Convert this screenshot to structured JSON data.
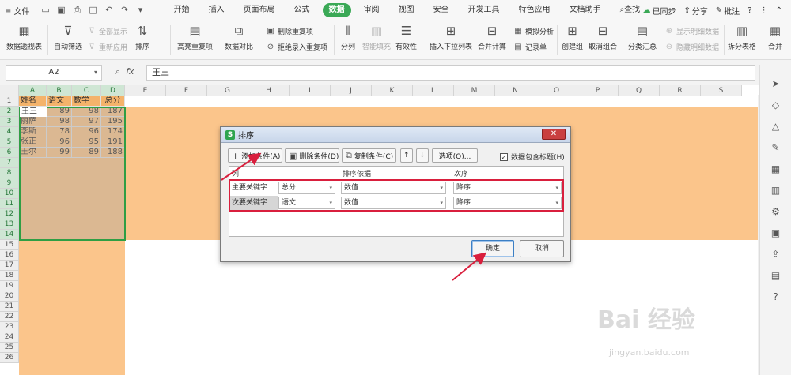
{
  "menubar": {
    "file_label": "≡ 文件",
    "tabs": [
      {
        "label": "开始",
        "active": false
      },
      {
        "label": "插入",
        "active": false
      },
      {
        "label": "页面布局",
        "active": false
      },
      {
        "label": "公式",
        "active": false
      },
      {
        "label": "数据",
        "active": true
      },
      {
        "label": "审阅",
        "active": false
      },
      {
        "label": "视图",
        "active": false
      },
      {
        "label": "安全",
        "active": false
      },
      {
        "label": "开发工具",
        "active": false
      },
      {
        "label": "特色应用",
        "active": false
      },
      {
        "label": "文档助手",
        "active": false
      }
    ],
    "search_label": "查找",
    "sync_label": "已同步",
    "share_label": "分享",
    "comment_label": "批注"
  },
  "ribbon": {
    "pivot": "数据透视表",
    "autofilter": "自动筛选",
    "show_all": "全部显示",
    "reapply": "重新应用",
    "sort": "排序",
    "highlight_dup": "高亮重复项",
    "compare": "数据对比",
    "del_dup": "删除重复项",
    "reject_dup": "拒绝录入重复项",
    "split": "分列",
    "smart_fill": "智能填充",
    "validity": "有效性",
    "insert_dropdown": "插入下拉列表",
    "merge_calc": "合并计算",
    "simulate": "模拟分析",
    "record": "记录单",
    "group": "创建组",
    "ungroup": "取消组合",
    "subtotal": "分类汇总",
    "show_detail": "显示明细数据",
    "hide_detail": "隐藏明细数据",
    "split_table": "拆分表格",
    "merge_more": "合并"
  },
  "formula_bar": {
    "cell_ref": "A2",
    "value": "王三"
  },
  "grid": {
    "columns": [
      "A",
      "B",
      "C",
      "D",
      "E",
      "F",
      "G",
      "H",
      "I",
      "J",
      "K",
      "L",
      "M",
      "N",
      "O",
      "P",
      "Q",
      "R",
      "S"
    ],
    "headers": [
      "姓名",
      "语文",
      "数学",
      "总分"
    ],
    "rows": [
      [
        "王三",
        "89",
        "98",
        "187"
      ],
      [
        "丽萨",
        "98",
        "97",
        "195"
      ],
      [
        "李斯",
        "78",
        "96",
        "174"
      ],
      [
        "张正",
        "96",
        "95",
        "191"
      ],
      [
        "王尔",
        "99",
        "89",
        "188"
      ]
    ],
    "row_numbers": [
      "1",
      "2",
      "3",
      "4",
      "5",
      "6",
      "7",
      "8",
      "9",
      "10",
      "11",
      "12",
      "13",
      "14",
      "15",
      "16",
      "17",
      "18",
      "19",
      "20",
      "21",
      "22",
      "23",
      "24",
      "25",
      "26"
    ]
  },
  "dialog": {
    "title": "排序",
    "add_condition": "添加条件(A)",
    "delete_condition": "删除条件(D)",
    "copy_condition": "复制条件(C)",
    "options": "选项(O)...",
    "has_header_label": "数据包含标题(H)",
    "has_header_checked": true,
    "col_header": "列",
    "basis_header": "排序依据",
    "order_header": "次序",
    "conditions": [
      {
        "label": "主要关键字",
        "column": "总分",
        "basis": "数值",
        "order": "降序"
      },
      {
        "label": "次要关键字",
        "column": "语文",
        "basis": "数值",
        "order": "降序"
      }
    ],
    "ok": "确定",
    "cancel": "取消"
  },
  "watermark": {
    "text": "Bai 经验",
    "url": "jingyan.baidu.com"
  },
  "colors": {
    "accent_green": "#3aa956",
    "orange_fill": "#fbc58b",
    "annotation_red": "#d91f3d"
  }
}
